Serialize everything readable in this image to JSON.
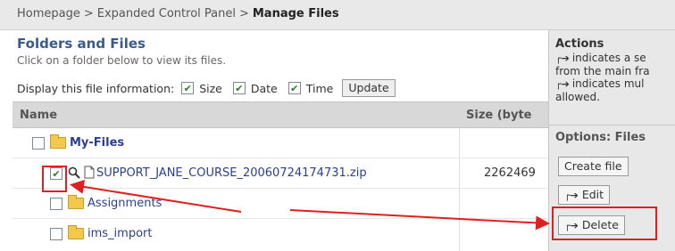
{
  "breadcrumb": {
    "items": [
      "Homepage",
      "Expanded Control Panel"
    ],
    "separator": ">",
    "current": "Manage Files"
  },
  "main": {
    "title": "Folders and Files",
    "subtitle": "Click on a folder below to view its files.",
    "display_label": "Display this file information:",
    "options": [
      {
        "label": "Size",
        "checked": true
      },
      {
        "label": "Date",
        "checked": true
      },
      {
        "label": "Time",
        "checked": true
      }
    ],
    "update_label": "Update",
    "columns": {
      "name": "Name",
      "size": "Size (byte"
    },
    "rows": [
      {
        "type": "root",
        "label": "My-Files",
        "checked": false
      },
      {
        "type": "file",
        "label": "SUPPORT_JANE_COURSE_20060724174731.zip",
        "size": "2262469",
        "checked": true
      },
      {
        "type": "folder",
        "label": "Assignments",
        "checked": false
      },
      {
        "type": "folder",
        "label": "ims_import",
        "checked": false
      }
    ]
  },
  "actions": {
    "title": "Actions",
    "line1": "indicates a se",
    "line2": "from the main fra",
    "line3": "indicates mul",
    "line4": "allowed.",
    "options_title": "Options: Files",
    "create_file": "Create file",
    "edit": "Edit",
    "delete": "Delete"
  },
  "colors": {
    "highlight": "#e02020",
    "link": "#2a3f8f",
    "header_bg": "#d8d8d8"
  }
}
